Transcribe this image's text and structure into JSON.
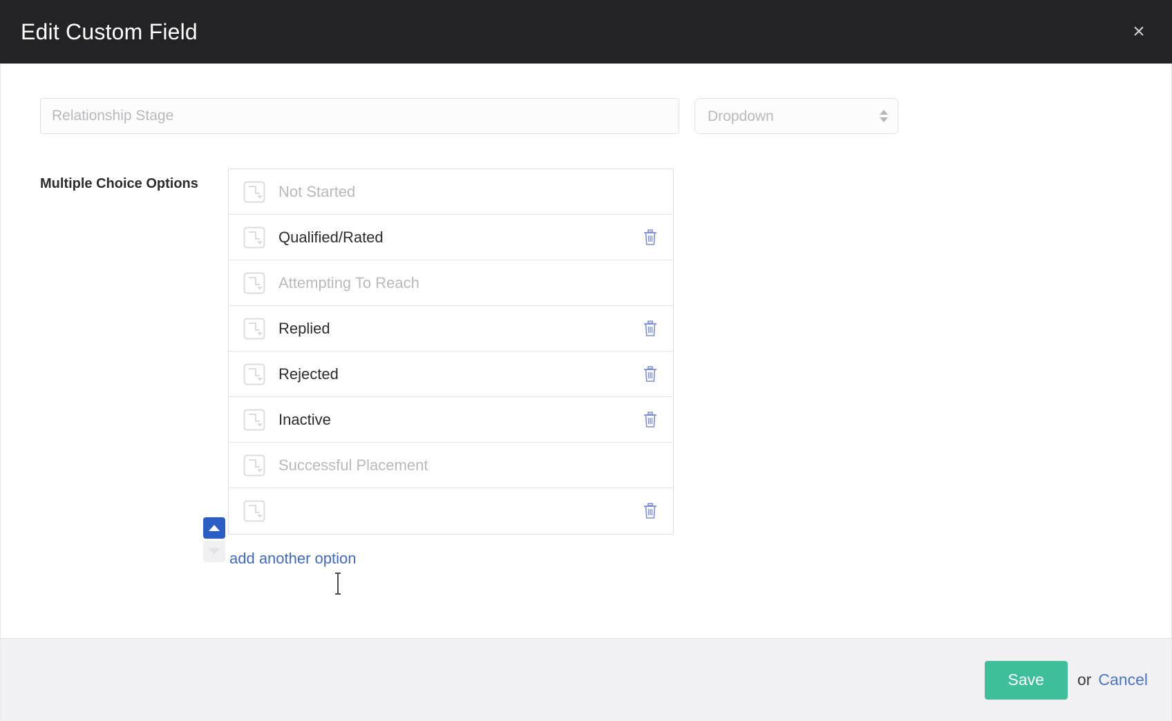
{
  "header": {
    "title": "Edit Custom Field",
    "close_label": "×"
  },
  "form": {
    "field_name_value": "",
    "field_name_placeholder": "Relationship Stage",
    "field_type_value": "Dropdown",
    "field_type_options": [
      "Dropdown"
    ],
    "options_label": "Multiple Choice Options"
  },
  "options": [
    {
      "value": "",
      "placeholder": "Not Started",
      "muted": true,
      "deletable": false
    },
    {
      "value": "Qualified/Rated",
      "placeholder": "",
      "muted": false,
      "deletable": true
    },
    {
      "value": "",
      "placeholder": "Attempting To Reach",
      "muted": true,
      "deletable": false
    },
    {
      "value": "Replied",
      "placeholder": "",
      "muted": false,
      "deletable": true
    },
    {
      "value": "Rejected",
      "placeholder": "",
      "muted": false,
      "deletable": true
    },
    {
      "value": "Inactive",
      "placeholder": "",
      "muted": false,
      "deletable": true
    },
    {
      "value": "",
      "placeholder": "Successful Placement",
      "muted": true,
      "deletable": false
    },
    {
      "value": "",
      "placeholder": "",
      "muted": false,
      "deletable": true
    }
  ],
  "actions": {
    "add_option_label": "add another option",
    "save_label": "Save",
    "or_label": "or",
    "cancel_label": "Cancel"
  },
  "colors": {
    "header_bg": "#232325",
    "save_green": "#3ebf99",
    "link_blue": "#3f69c4",
    "trash_blue": "#7d8ed8",
    "sort_active_blue": "#2a5ec4",
    "footer_bg": "#f1f0f3",
    "muted_text": "#b9b9bd"
  }
}
